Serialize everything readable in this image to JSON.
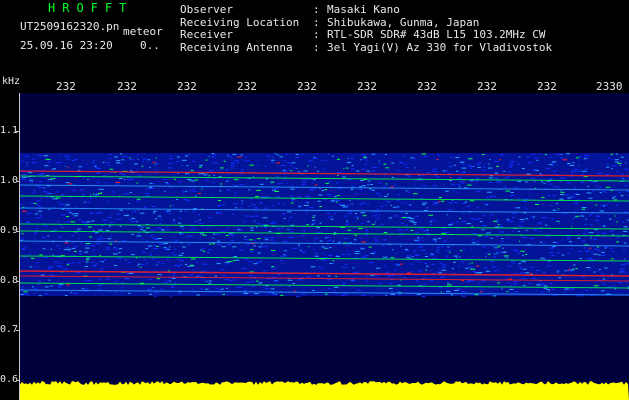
{
  "header": {
    "logo": "HROFFT",
    "filename": "UT2509162320.pn",
    "mode": "meteor",
    "datetime": "25.09.16 23:20",
    "count": "0..",
    "info": [
      {
        "label": "Observer",
        "value": "Masaki Kano"
      },
      {
        "label": "Receiving Location",
        "value": "Shibukawa, Gunma, Japan"
      },
      {
        "label": "Receiver",
        "value": "RTL-SDR SDR# 43dB L15 103.2MHz CW"
      },
      {
        "label": "Receiving Antenna",
        "value": "3el Yagi(V) Az 330 for Vladivostok"
      }
    ]
  },
  "axis": {
    "unit": "kHz",
    "time_ticks": [
      "232",
      "232",
      "232",
      "232",
      "232",
      "232",
      "232",
      "232",
      "232",
      "2330"
    ],
    "freq_ticks": [
      "1.1",
      "1.0",
      "0.9",
      "0.8",
      "0.7",
      "0.6"
    ]
  },
  "colors": {
    "background": "#000000",
    "plot_background": "#00003c",
    "logo": "#00ff20",
    "text": "#e8e8e8",
    "echo_strong": "#ff2020",
    "echo_mid": "#00ff40",
    "noise": "#1030ff",
    "meter": "#ffff00"
  }
}
